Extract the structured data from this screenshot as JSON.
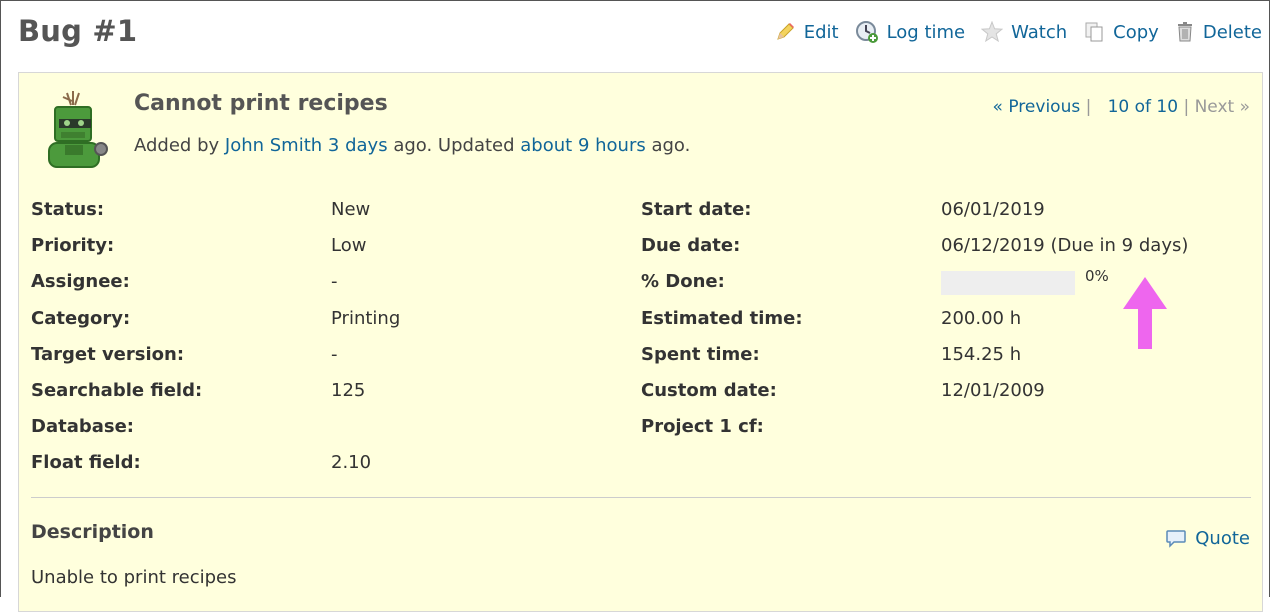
{
  "issue": {
    "title": "Bug #1",
    "subject": "Cannot print recipes"
  },
  "actions": {
    "edit": "Edit",
    "log_time": "Log time",
    "watch": "Watch",
    "copy": "Copy",
    "delete": "Delete"
  },
  "author": {
    "prefix": "Added by",
    "name": "John Smith",
    "added": "3 days",
    "mid": "ago. Updated",
    "updated": "about 9 hours",
    "suffix": "ago."
  },
  "nav": {
    "previous": "« Previous",
    "sep1": "|",
    "position": "10 of 10",
    "sep2": "|",
    "next": "Next »"
  },
  "left_attrs": [
    {
      "label": "Status:",
      "value": "New"
    },
    {
      "label": "Priority:",
      "value": "Low"
    },
    {
      "label": "Assignee:",
      "value": "-"
    },
    {
      "label": "Category:",
      "value": "Printing"
    },
    {
      "label": "Target version:",
      "value": "-"
    },
    {
      "label": "Searchable field:",
      "value": "125"
    },
    {
      "label": "Database:",
      "value": ""
    },
    {
      "label": "Float field:",
      "value": "2.10"
    }
  ],
  "right_attrs": [
    {
      "label": "Start date:",
      "value": "06/01/2019"
    },
    {
      "label": "Due date:",
      "value": "06/12/2019 (Due in 9 days)"
    },
    {
      "label": "% Done:",
      "value": "0%"
    },
    {
      "label": "Estimated time:",
      "value": "200.00 h"
    },
    {
      "label": "Spent time:",
      "value": "154.25 h"
    },
    {
      "label": "Custom date:",
      "value": "12/01/2009"
    },
    {
      "label": "Project 1 cf:",
      "value": ""
    }
  ],
  "done_ratio": 0,
  "description": {
    "heading": "Description",
    "quote": "Quote",
    "text": "Unable to print recipes"
  },
  "colors": {
    "link": "#116699",
    "panel_bg": "#ffffdd",
    "annotation_arrow": "#ee66ee"
  }
}
